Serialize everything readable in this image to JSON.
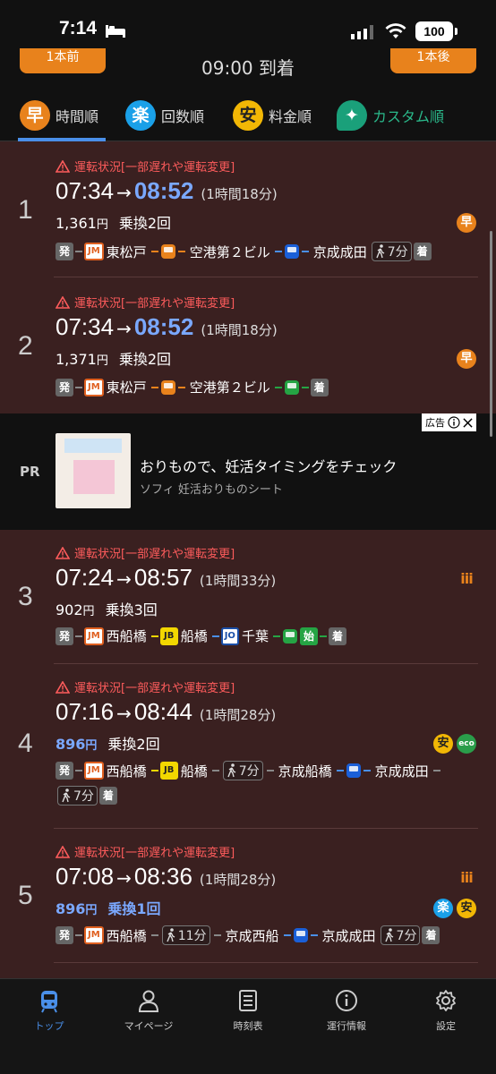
{
  "status_bar": {
    "time": "7:14",
    "battery": "100"
  },
  "nav": {
    "prev_label": "1本前",
    "next_label": "1本後",
    "arrival_title": "09:00 到着"
  },
  "sort_tabs": [
    {
      "icon": "早",
      "label": "時間順",
      "color": "#e8821c",
      "active": true
    },
    {
      "icon": "楽",
      "label": "回数順",
      "color": "#1aa0e8",
      "active": false
    },
    {
      "icon": "安",
      "label": "料金順",
      "color": "#f2b705",
      "active": false
    },
    {
      "icon": "✦",
      "label": "カスタム順",
      "color": "#1aa07a",
      "active": false
    }
  ],
  "routes": [
    {
      "number": "1",
      "warning": "運転状況[一部遅れや運転変更]",
      "dep": "07:34",
      "arrow": "→",
      "arr": "08:52",
      "duration": "(1時間18分)",
      "fare": "1,361",
      "yen": "円",
      "transfers": "乗換2回",
      "badges": [
        "早"
      ],
      "path": {
        "start": "発",
        "jm": "JM",
        "s1": "東松戸",
        "s2": "空港第２ビル",
        "s3": "京成成田",
        "walk": "7分",
        "end": "着"
      }
    },
    {
      "number": "2",
      "warning": "運転状況[一部遅れや運転変更]",
      "dep": "07:34",
      "arrow": "→",
      "arr": "08:52",
      "duration": "(1時間18分)",
      "fare": "1,371",
      "yen": "円",
      "transfers": "乗換2回",
      "badges": [
        "早"
      ],
      "path": {
        "start": "発",
        "jm": "JM",
        "s1": "東松戸",
        "s2": "空港第２ビル",
        "end": "着"
      }
    },
    {
      "number": "3",
      "warning": "運転状況[一部遅れや運転変更]",
      "dep": "07:24",
      "arrow": "→",
      "arr": "08:57",
      "duration": "(1時間33分)",
      "fare": "902",
      "yen": "円",
      "transfers": "乗換3回",
      "badges": [
        "iii"
      ],
      "path": {
        "start": "発",
        "jm": "JM",
        "s1": "西船橋",
        "jb": "JB",
        "s2": "船橋",
        "jo": "JO",
        "s3": "千葉",
        "shi": "始",
        "end": "着"
      }
    },
    {
      "number": "4",
      "warning": "運転状況[一部遅れや運転変更]",
      "dep": "07:16",
      "arrow": "→",
      "arr": "08:44",
      "duration": "(1時間28分)",
      "fare": "896",
      "yen": "円",
      "transfers": "乗換2回",
      "badges": [
        "安",
        "eco"
      ],
      "path": {
        "start": "発",
        "jm": "JM",
        "s1": "西船橋",
        "jb": "JB",
        "s2": "船橋",
        "walk1": "7分",
        "s3": "京成船橋",
        "s4": "京成成田",
        "walk2": "7分",
        "end": "着"
      }
    },
    {
      "number": "5",
      "warning": "運転状況[一部遅れや運転変更]",
      "dep": "07:08",
      "arrow": "→",
      "arr": "08:36",
      "duration": "(1時間28分)",
      "fare": "896",
      "yen": "円",
      "transfers": "乗換1回",
      "badges": [
        "iii",
        "楽",
        "安"
      ],
      "path": {
        "start": "発",
        "jm": "JM",
        "s1": "西船橋",
        "walk1": "11分",
        "s2": "京成西船",
        "s3": "京成成田",
        "walk2": "7分",
        "end": "着"
      }
    }
  ],
  "ad": {
    "pr": "PR",
    "tag": "広告",
    "title": "おりもので、妊活タイミングをチェック",
    "subtitle": "ソフィ 妊活おりものシート"
  },
  "tabbar": [
    {
      "label": "トップ",
      "icon": "train-icon",
      "active": true
    },
    {
      "label": "マイページ",
      "icon": "person-icon",
      "active": false
    },
    {
      "label": "時刻表",
      "icon": "timetable-icon",
      "active": false
    },
    {
      "label": "運行情報",
      "icon": "info-icon",
      "active": false
    },
    {
      "label": "設定",
      "icon": "gear-icon",
      "active": false
    }
  ],
  "colors": {
    "accent": "#4a8fe8",
    "warning": "#ff5c5c",
    "list_bg": "#3a2020",
    "brand_orange": "#e8821c"
  }
}
